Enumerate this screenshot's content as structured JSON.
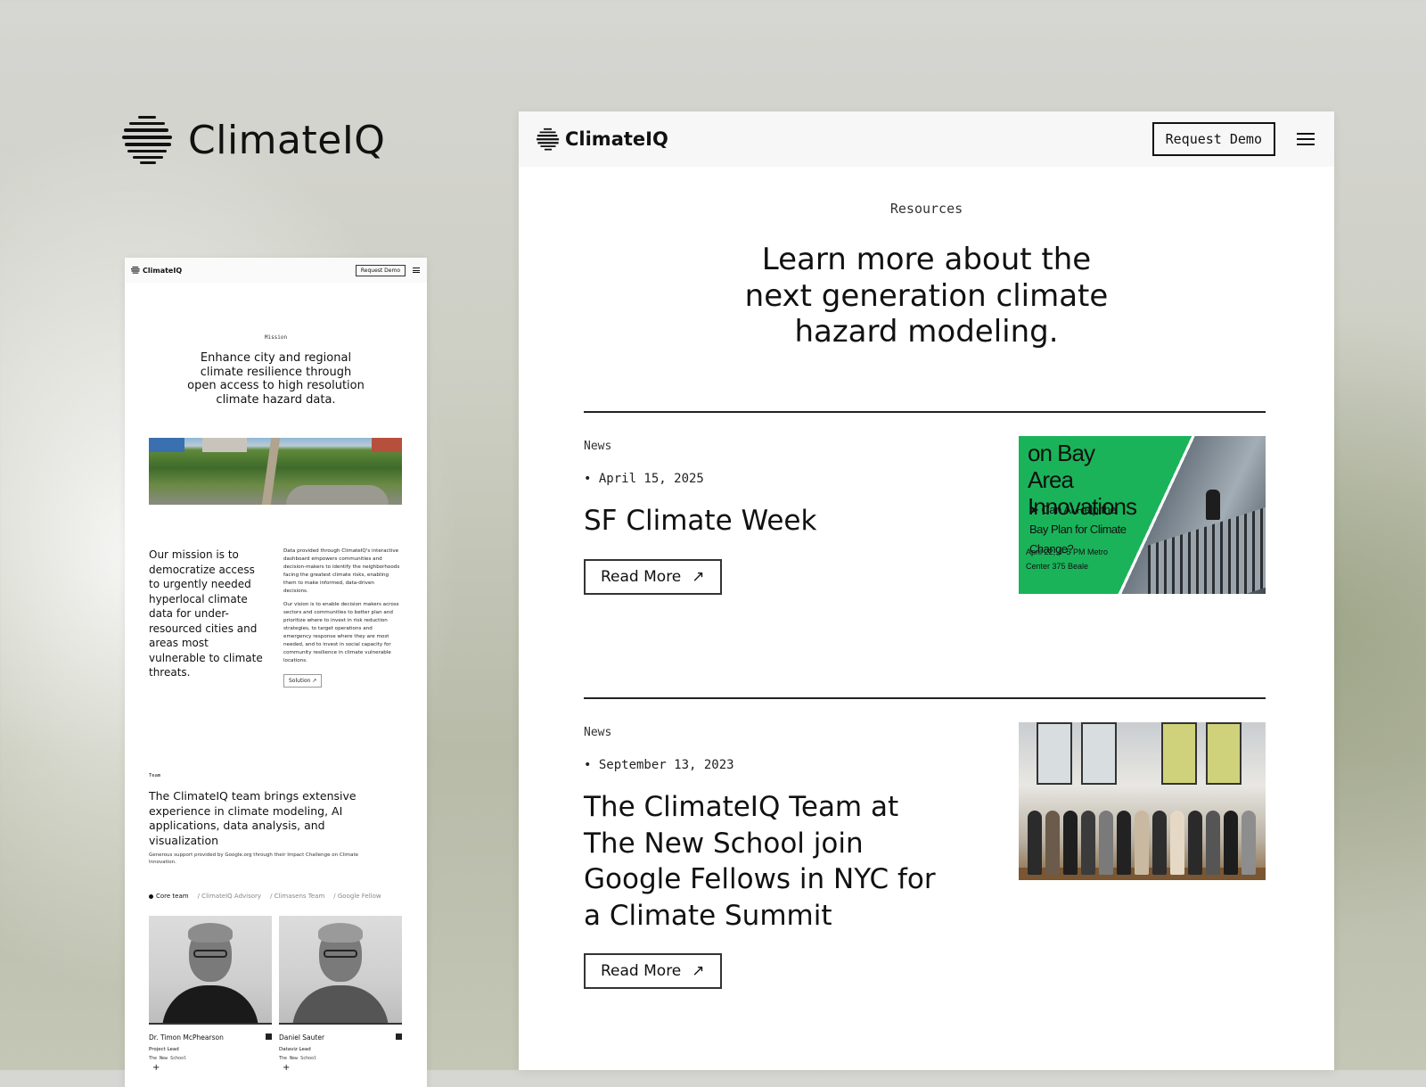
{
  "brand": {
    "name": "ClimateIQ"
  },
  "mobile": {
    "nav": {
      "brand": "ClimateIQ",
      "request_demo": "Request Demo"
    },
    "mission_eyebrow": "Mission",
    "headline": "Enhance city and regional climate resilience through open access to high resolution climate hazard data.",
    "mission_text": "Our mission is to democratize access to urgently needed hyperlocal climate data for under-resourced cities and areas most vulnerable to climate threats.",
    "side_p1": "Data provided through ClimateIQ's interactive dashboard empowers communities and decision-makers to identify the neighborhoods facing the greatest climate risks, enabling them to make informed, data-driven decisions.",
    "side_p2": "Our vision is to enable decision makers across sectors and communities to better plan and prioritize where to invest in risk reduction strategies, to target operations and emergency response where they are most needed, and to invest in social capacity for community resilience in climate vulnerable locations.",
    "solution_button": "Solution",
    "team_eyebrow": "Team",
    "team_headline": "The ClimateIQ team brings extensive experience in climate modeling, AI applications, data analysis, and visualization",
    "team_sub": "Generous support provided by Google.org through their Impact Challenge on Climate Innovation.",
    "tabs": [
      "Core team",
      "/ ClimateIQ Advisory",
      "/ Climasens Team",
      "/ Google Fellow"
    ],
    "people": [
      {
        "name": "Dr. Timon McPhearson",
        "role": "Project Lead",
        "org": "The New School"
      },
      {
        "name": "Daniel Sauter",
        "role": "Dataviz Lead",
        "org": "The New School"
      }
    ],
    "arrow_glyph": "↗",
    "plus_glyph": "+"
  },
  "desktop": {
    "nav": {
      "brand": "ClimateIQ",
      "request_demo": "Request Demo"
    },
    "eyebrow": "Resources",
    "headline": "Learn more about the next generation climate hazard modeling.",
    "articles": [
      {
        "tag": "News",
        "date": "• April 15, 2025",
        "title": "SF Climate Week",
        "read_more": "Read More",
        "image_text": {
          "heading": "on Bay Area Innovations",
          "sub": "➤ Can AI Help the Bay Plan for Climate Change?",
          "meta": "April 22, 4–5 PM Metro Center 375 Beale"
        }
      },
      {
        "tag": "News",
        "date": "• September 13, 2023",
        "title": "The ClimateIQ Team at The New School join Google Fellows in NYC for a Climate Summit",
        "read_more": "Read More"
      }
    ],
    "arrow_glyph": "↗"
  },
  "colors": {
    "accent_green": "#1bb35a",
    "text": "#111111",
    "frame_bg": "#ffffff"
  },
  "icons": [
    "climateiq-logo-icon",
    "menu-icon",
    "arrow-up-right-icon",
    "linkedin-icon",
    "plus-icon"
  ]
}
